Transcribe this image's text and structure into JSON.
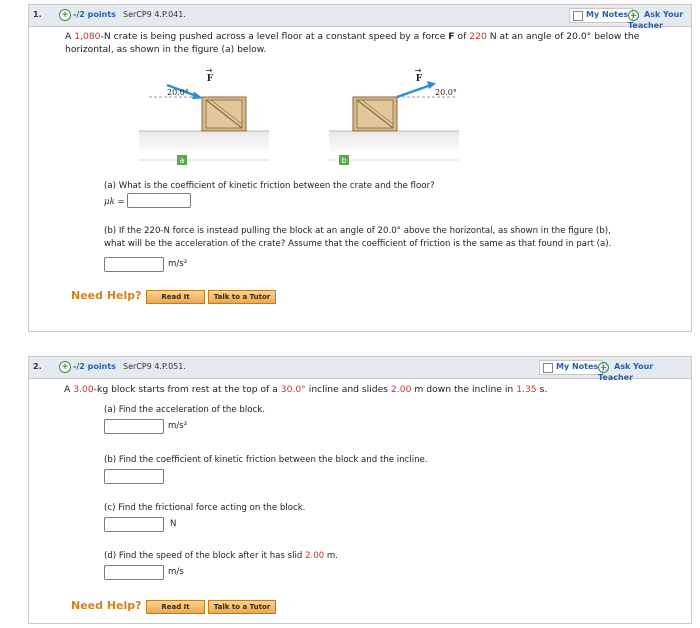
{
  "problem1": {
    "number": "1.",
    "points": "-/2 points",
    "code": "SerCP9 4.P.041.",
    "my_notes": "My Notes",
    "ask_teacher": "Ask Your Teacher",
    "stem_a": "A ",
    "stem_weight": "1,080",
    "stem_b": "-N crate is being pushed across a level floor at a constant speed by a force ",
    "stem_f": "F",
    "stem_c": " of ",
    "stem_force": "220",
    "stem_d": " N at an angle of 20.0° below the",
    "stem_line2": "horizontal, as shown in the figure (a) below.",
    "fig_a_angle": "20.0°",
    "fig_b_angle": "20.0°",
    "fig_force_label": "F",
    "fig_a_label": "a",
    "fig_b_label": "b",
    "part_a": "(a) What is the coefficient of kinetic friction between the crate and the floor?",
    "mu_label": "μk =",
    "part_b_line1": "(b) If the 220-N force is instead pulling the block at an angle of 20.0° above the horizontal, as shown in the figure (b),",
    "part_b_line2": "what will be the acceleration of the crate? Assume that the coefficient of friction is the same as that found in part (a).",
    "unit_b": "m/s²",
    "need_help": "Need Help?",
    "read_it": "Read It",
    "talk_tutor": "Talk to a Tutor"
  },
  "problem2": {
    "number": "2.",
    "points": "-/2 points",
    "code": "SerCP9 4.P.051.",
    "my_notes": "My Notes",
    "ask_teacher": "Ask Your Teacher",
    "stem_a": "A ",
    "stem_mass": "3.00",
    "stem_b": "-kg block starts from rest at the top of a ",
    "stem_angle": "30.0°",
    "stem_c": " incline and slides ",
    "stem_dist": "2.00",
    "stem_d": " m down the incline in ",
    "stem_time": "1.35",
    "stem_e": " s.",
    "part_a": "(a) Find the acceleration of the block.",
    "unit_a": "m/s²",
    "part_b": "(b) Find the coefficient of kinetic friction between the block and the incline.",
    "part_c": "(c) Find the frictional force acting on the block.",
    "unit_c": "N",
    "part_d_a": "(d) Find the speed of the block after it has slid ",
    "part_d_dist": "2.00",
    "part_d_b": " m.",
    "unit_d": "m/s",
    "need_help": "Need Help?",
    "read_it": "Read It",
    "talk_tutor": "Talk to a Tutor"
  },
  "colors": {
    "accent_red": "#c0392b",
    "link_blue": "#2a5db0",
    "help_orange": "#d4821a",
    "arrow_blue": "#2b8fd1",
    "crate_tan": "#d8b98a",
    "label_green": "#5aa84a"
  }
}
